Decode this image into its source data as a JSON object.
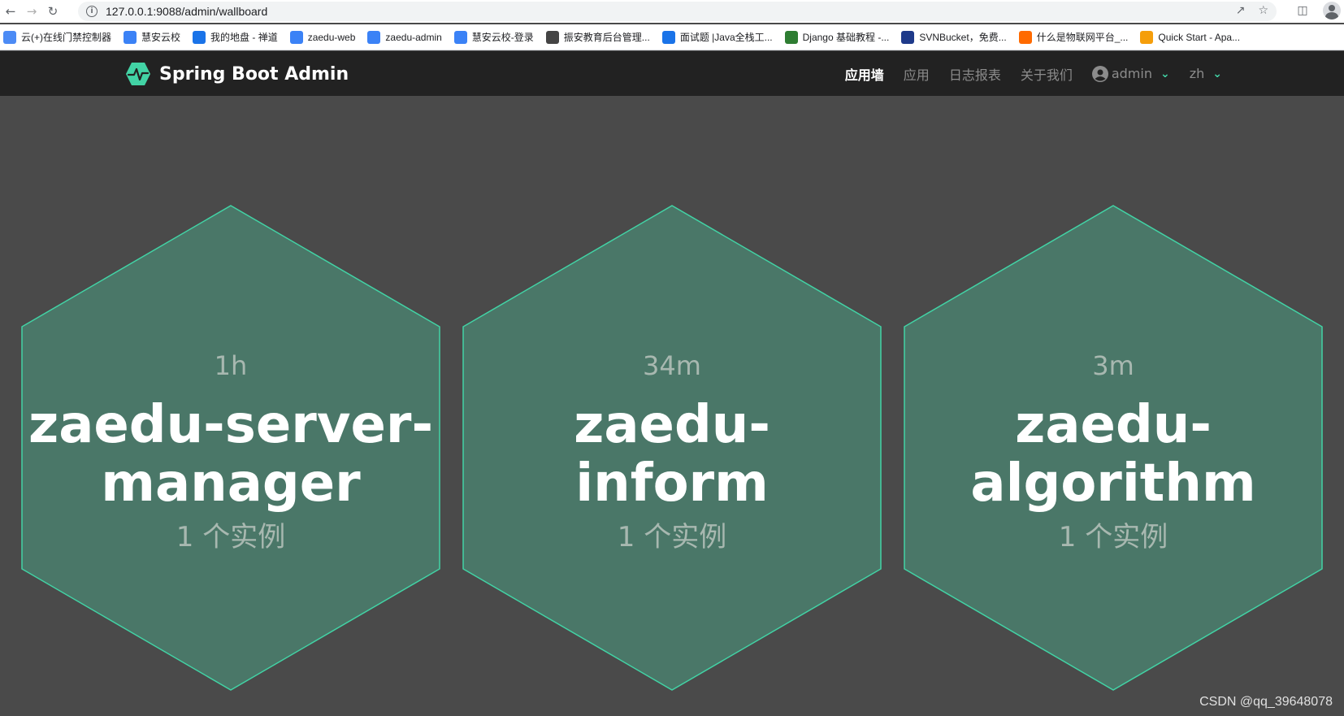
{
  "browser": {
    "url": "127.0.0.1:9088/admin/wallboard",
    "bookmarks": [
      {
        "label": "云(+)在线门禁控制器",
        "color": "#4c8bf5"
      },
      {
        "label": "慧安云校",
        "color": "#3b82f6"
      },
      {
        "label": "我的地盘 - 禅道",
        "color": "#1a73e8"
      },
      {
        "label": "zaedu-web",
        "color": "#3b82f6"
      },
      {
        "label": "zaedu-admin",
        "color": "#3b82f6"
      },
      {
        "label": "慧安云校-登录",
        "color": "#3b82f6"
      },
      {
        "label": "振安教育后台管理...",
        "color": "#444444"
      },
      {
        "label": "面试题 |Java全栈工...",
        "color": "#1a73e8"
      },
      {
        "label": "Django 基础教程 -...",
        "color": "#2e7d32"
      },
      {
        "label": "SVNBucket，免费...",
        "color": "#1e3a8a"
      },
      {
        "label": "什么是物联网平台_...",
        "color": "#ff6a00"
      },
      {
        "label": "Quick Start - Apa...",
        "color": "#f59e0b"
      }
    ]
  },
  "navbar": {
    "brand": "Spring Boot Admin",
    "items": [
      {
        "label": "应用墙",
        "active": true
      },
      {
        "label": "应用",
        "active": false
      },
      {
        "label": "日志报表",
        "active": false
      },
      {
        "label": "关于我们",
        "active": false
      }
    ],
    "user": "admin",
    "lang": "zh"
  },
  "wallboard": {
    "hex_fill": "#4a7768",
    "hex_stroke": "#42d3a5",
    "apps": [
      {
        "uptime": "1h",
        "name_line1": "zaedu-server-",
        "name_line2": "manager",
        "instances": "1 个实例"
      },
      {
        "uptime": "34m",
        "name_line1": "zaedu-",
        "name_line2": "inform",
        "instances": "1 个实例"
      },
      {
        "uptime": "3m",
        "name_line1": "zaedu-",
        "name_line2": "algorithm",
        "instances": "1 个实例"
      }
    ]
  },
  "watermark": "CSDN @qq_39648078"
}
